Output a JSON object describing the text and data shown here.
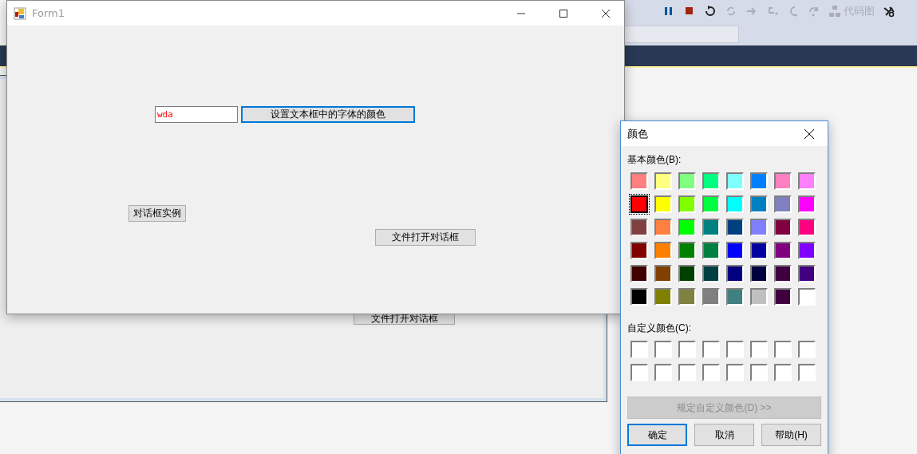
{
  "ide": {
    "toolbar": [
      {
        "kind": "pause",
        "disabled": false
      },
      {
        "kind": "stop",
        "disabled": false
      },
      {
        "kind": "restart",
        "disabled": false
      },
      {
        "kind": "refresh",
        "disabled": true
      },
      {
        "kind": "step-arrow",
        "disabled": true
      },
      {
        "kind": "step-into",
        "disabled": true
      },
      {
        "kind": "step-out",
        "disabled": true
      },
      {
        "kind": "step-back",
        "disabled": true
      },
      {
        "kind": "code-map",
        "disabled": true,
        "label": "代码图"
      },
      {
        "kind": "tools",
        "disabled": false
      }
    ],
    "designer": {
      "buttons": [
        {
          "label": "文件打开对话框"
        }
      ]
    }
  },
  "form": {
    "title": "Form1",
    "text_field": {
      "value": "wda"
    },
    "buttons": [
      {
        "label": "设置文本框中的字体的颜色",
        "focused": true
      },
      {
        "label": "对话框实例",
        "focused": false
      },
      {
        "label": "文件打开对话框",
        "focused": false
      }
    ]
  },
  "dialog": {
    "title": "颜色",
    "basic_label": "基本颜色(B):",
    "swatches": [
      {
        "color": "#ff8080",
        "selected": false
      },
      {
        "color": "#ffff80",
        "selected": false
      },
      {
        "color": "#80ff80",
        "selected": false
      },
      {
        "color": "#00ff80",
        "selected": false
      },
      {
        "color": "#80ffff",
        "selected": false
      },
      {
        "color": "#0080ff",
        "selected": false
      },
      {
        "color": "#ff80c0",
        "selected": false
      },
      {
        "color": "#ff80ff",
        "selected": false
      },
      {
        "color": "#ff0000",
        "selected": true
      },
      {
        "color": "#ffff00",
        "selected": false
      },
      {
        "color": "#80ff00",
        "selected": false
      },
      {
        "color": "#00ff40",
        "selected": false
      },
      {
        "color": "#00ffff",
        "selected": false
      },
      {
        "color": "#0080c0",
        "selected": false
      },
      {
        "color": "#8080c0",
        "selected": false
      },
      {
        "color": "#ff00ff",
        "selected": false
      },
      {
        "color": "#804040",
        "selected": false
      },
      {
        "color": "#ff8040",
        "selected": false
      },
      {
        "color": "#00ff00",
        "selected": false
      },
      {
        "color": "#008080",
        "selected": false
      },
      {
        "color": "#004080",
        "selected": false
      },
      {
        "color": "#8080ff",
        "selected": false
      },
      {
        "color": "#800040",
        "selected": false
      },
      {
        "color": "#ff0080",
        "selected": false
      },
      {
        "color": "#800000",
        "selected": false
      },
      {
        "color": "#ff8000",
        "selected": false
      },
      {
        "color": "#008000",
        "selected": false
      },
      {
        "color": "#008040",
        "selected": false
      },
      {
        "color": "#0000ff",
        "selected": false
      },
      {
        "color": "#0000a0",
        "selected": false
      },
      {
        "color": "#800080",
        "selected": false
      },
      {
        "color": "#8000ff",
        "selected": false
      },
      {
        "color": "#400000",
        "selected": false
      },
      {
        "color": "#804000",
        "selected": false
      },
      {
        "color": "#004000",
        "selected": false
      },
      {
        "color": "#004040",
        "selected": false
      },
      {
        "color": "#000080",
        "selected": false
      },
      {
        "color": "#000040",
        "selected": false
      },
      {
        "color": "#400040",
        "selected": false
      },
      {
        "color": "#400080",
        "selected": false
      },
      {
        "color": "#000000",
        "selected": false
      },
      {
        "color": "#808000",
        "selected": false
      },
      {
        "color": "#808040",
        "selected": false
      },
      {
        "color": "#808080",
        "selected": false
      },
      {
        "color": "#408080",
        "selected": false
      },
      {
        "color": "#c0c0c0",
        "selected": false
      },
      {
        "color": "#400040",
        "selected": false
      },
      {
        "color": "#ffffff",
        "selected": false
      }
    ],
    "custom_label": "自定义颜色(C):",
    "custom_swatches": [
      {
        "color": "#ffffff"
      },
      {
        "color": "#ffffff"
      },
      {
        "color": "#ffffff"
      },
      {
        "color": "#ffffff"
      },
      {
        "color": "#ffffff"
      },
      {
        "color": "#ffffff"
      },
      {
        "color": "#ffffff"
      },
      {
        "color": "#ffffff"
      },
      {
        "color": "#ffffff"
      },
      {
        "color": "#ffffff"
      },
      {
        "color": "#ffffff"
      },
      {
        "color": "#ffffff"
      },
      {
        "color": "#ffffff"
      },
      {
        "color": "#ffffff"
      },
      {
        "color": "#ffffff"
      },
      {
        "color": "#ffffff"
      }
    ],
    "define_button": {
      "label": "规定自定义颜色(D) >>",
      "disabled": true
    },
    "buttons": [
      {
        "label": "确定",
        "default": true
      },
      {
        "label": "取消",
        "default": false
      },
      {
        "label": "帮助(H)",
        "default": false
      }
    ]
  }
}
